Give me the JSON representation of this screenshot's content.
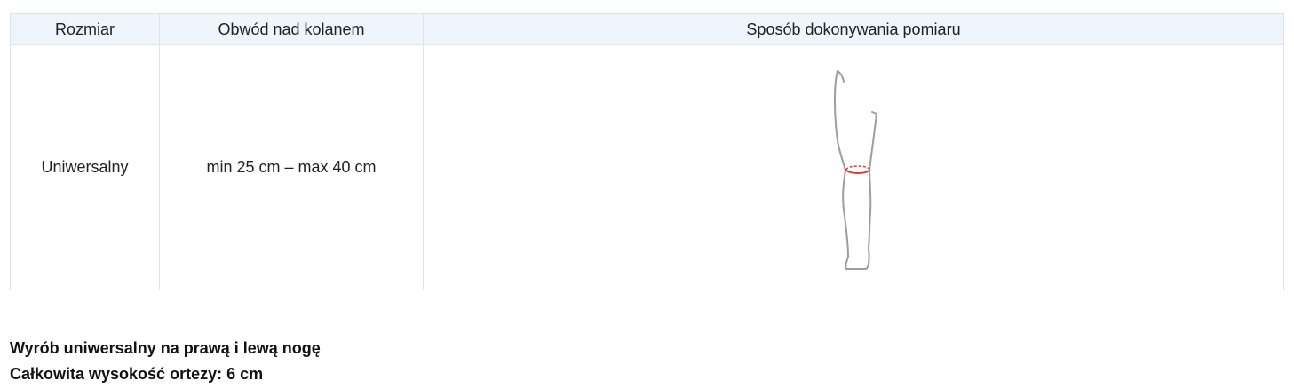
{
  "table": {
    "headers": [
      "Rozmiar",
      "Obwód nad kolanem",
      "Sposób dokonywania pomiaru"
    ],
    "rows": [
      {
        "size": "Uniwersalny",
        "circumference": "min 25 cm – max 40 cm",
        "image": "leg-measurement-diagram"
      }
    ]
  },
  "notes": [
    "Wyrób uniwersalny na prawą i lewą nogę",
    "Całkowita wysokość ortezy: 6 cm"
  ],
  "colors": {
    "header_bg": "#eef5fd",
    "border": "#dfe3e8",
    "leg_outline": "#9e9e9e",
    "measure_line": "#e53935"
  }
}
